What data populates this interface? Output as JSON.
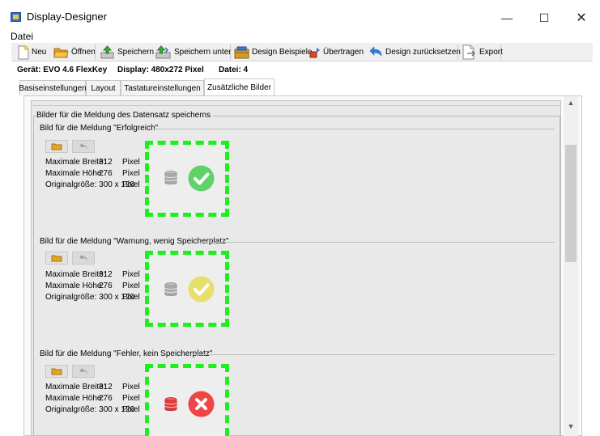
{
  "window": {
    "title": "Display-Designer",
    "minimize_glyph": "—",
    "maximize_glyph": "☐",
    "close_glyph": "✕"
  },
  "menu": {
    "datei": "Datei"
  },
  "toolbar": {
    "new": "Neu",
    "open": "Öffnen",
    "save": "Speichern",
    "save_as": "Speichern unter",
    "design_examples": "Design Beispiele",
    "transfer": "Übertragen",
    "reset_design": "Design zurücksetzen",
    "export": "Export"
  },
  "info": {
    "device": "Gerät: EVO 4.6 FlexKey",
    "display": "Display: 480x272 Pixel",
    "file": "Datei: 4"
  },
  "tabs": [
    {
      "label": "Basiseinstellungen",
      "active": false
    },
    {
      "label": "Layout",
      "active": false
    },
    {
      "label": "Tastatureinstellungen",
      "active": false
    },
    {
      "label": "Zusätzliche Bilder",
      "active": true
    }
  ],
  "scrollbar": {
    "up_glyph": "▲",
    "down_glyph": "▼"
  },
  "group": {
    "title": "Bilder für die Meldung des Datensatz speicherns"
  },
  "sections": [
    {
      "title": "Bild für die Meldung \"Erfolgreich\"",
      "max_width_label": "Maximale Breite:",
      "max_width_value": "312",
      "max_height_label": "Maximale Höhe:",
      "max_height_value": "276",
      "original_size": "Originalgröße: 300 x 120",
      "unit": "Pixel",
      "db_color": "#a9a9a9",
      "status_color": "#5fd36a",
      "status_icon": "check-circle-icon"
    },
    {
      "title": "Bild für die Meldung \"Warnung, wenig Speicherplatz\"",
      "max_width_label": "Maximale Breite:",
      "max_width_value": "312",
      "max_height_label": "Maximale Höhe:",
      "max_height_value": "276",
      "original_size": "Originalgröße: 300 x 120",
      "unit": "Pixel",
      "db_color": "#a9a9a9",
      "status_color": "#e8de6c",
      "status_icon": "check-circle-icon"
    },
    {
      "title": "Bild für die Meldung \"Fehler, kein Speicherplatz\"",
      "max_width_label": "Maximale Breite:",
      "max_width_value": "312",
      "max_height_label": "Maximale Höhe:",
      "max_height_value": "276",
      "original_size": "Originalgröße: 300 x 120",
      "unit": "Pixel",
      "db_color": "#e23b3b",
      "status_color": "#ef4545",
      "status_icon": "x-circle-icon"
    }
  ],
  "colors": {
    "preview_border": "#1ef01e",
    "panel_bg": "#e9e9e9"
  }
}
